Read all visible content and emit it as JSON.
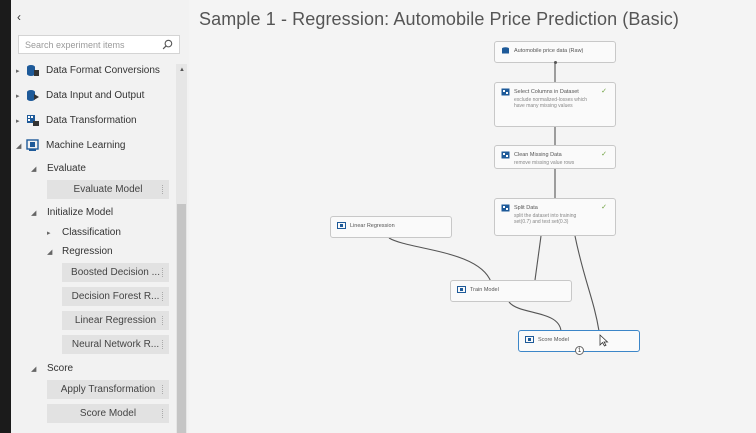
{
  "sidebar": {
    "search_placeholder": "Search experiment items",
    "categories": [
      {
        "label": "Data Format Conversions"
      },
      {
        "label": "Data Input and Output"
      },
      {
        "label": "Data Transformation"
      },
      {
        "label": "Machine Learning"
      }
    ],
    "evaluate": {
      "label": "Evaluate",
      "items": [
        "Evaluate Model"
      ]
    },
    "initialize_model": {
      "label": "Initialize Model",
      "classification": "Classification",
      "regression": "Regression",
      "regression_items": [
        "Boosted Decision ...",
        "Decision Forest R...",
        "Linear Regression",
        "Neural Network R..."
      ]
    },
    "score": {
      "label": "Score",
      "items": [
        "Apply Transformation",
        "Score Model"
      ]
    }
  },
  "canvas": {
    "title": "Sample 1 - Regression: Automobile Price Prediction (Basic)",
    "nodes": {
      "price_data": {
        "name": "Automobile price data (Raw)"
      },
      "select_columns": {
        "name": "Select Columns in Dataset",
        "desc": "exclude normalized-losses which have many missing values"
      },
      "clean_missing": {
        "name": "Clean Missing Data",
        "desc": "remove missing value rows"
      },
      "split_data": {
        "name": "Split Data",
        "desc": "split the dataset into training set(0.7) and test set(0.3)"
      },
      "linear_regression": {
        "name": "Linear Regression"
      },
      "train_model": {
        "name": "Train Model"
      },
      "score_model": {
        "name": "Score Model",
        "port": "1"
      }
    },
    "status_check": "✓"
  },
  "icons": {
    "collapse": "chevron-left-icon",
    "search": "search-icon"
  }
}
